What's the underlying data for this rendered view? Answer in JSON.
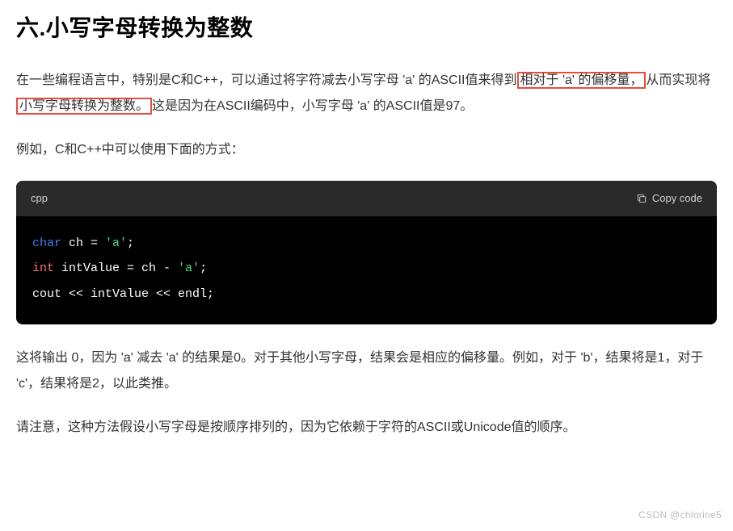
{
  "heading": "六.小写字母转换为整数",
  "para1": {
    "t1": "在一些编程语言中，特别是C和C++，可以通过将字符减去小写字母 'a' 的ASCII值来得到",
    "hl1": "相对于 'a' 的偏移量，",
    "t2": "从而实现将",
    "hl2": "小写字母转换为整数。",
    "t3": "这是因为在ASCII编码中，小写字母 'a' 的ASCII值是97。"
  },
  "para2": "例如，C和C++中可以使用下面的方式：",
  "code": {
    "lang": "cpp",
    "copy_label": "Copy code",
    "line1_kw": "char",
    "line1_rest": " ch = ",
    "line1_str": "'a'",
    "line1_end": ";",
    "line2_kw": "int",
    "line2_rest": " intValue = ch - ",
    "line2_str": "'a'",
    "line2_end": ";",
    "line3": "cout << intValue << endl;"
  },
  "para3": "这将输出 0，因为 'a' 减去 'a' 的结果是0。对于其他小写字母，结果会是相应的偏移量。例如，对于 'b'，结果将是1，对于 'c'，结果将是2，以此类推。",
  "para4": "请注意，这种方法假设小写字母是按顺序排列的，因为它依赖于字符的ASCII或Unicode值的顺序。",
  "watermark": "CSDN @chlorine5"
}
